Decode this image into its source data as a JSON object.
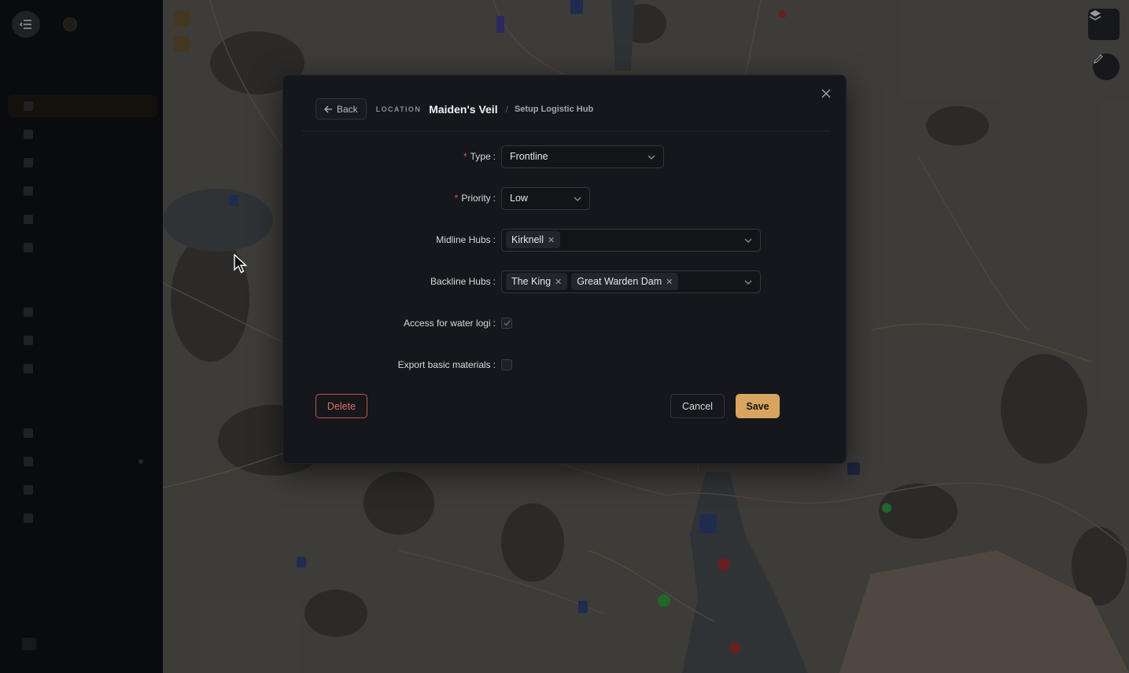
{
  "modal": {
    "back_label": "Back",
    "location_label": "LOCATION",
    "location_name": "Maiden's Veil",
    "separator": "/",
    "subtitle": "Setup Logistic Hub",
    "fields": {
      "type": {
        "label": "Type",
        "value": "Frontline",
        "required": true
      },
      "priority": {
        "label": "Priority",
        "value": "Low",
        "required": true
      },
      "midline_hubs": {
        "label": "Midline Hubs",
        "tags": [
          "Kirknell"
        ]
      },
      "backline_hubs": {
        "label": "Backline Hubs",
        "tags": [
          "The King",
          "Great Warden Dam"
        ]
      },
      "water_logi": {
        "label": "Access for water logi",
        "checked": true
      },
      "export_basic": {
        "label": "Export basic materials",
        "checked": false
      }
    },
    "buttons": {
      "delete": "Delete",
      "cancel": "Cancel",
      "save": "Save"
    }
  },
  "colors": {
    "accent": "#d9a45e",
    "danger": "#e46c63",
    "modal_bg": "#15171c"
  }
}
